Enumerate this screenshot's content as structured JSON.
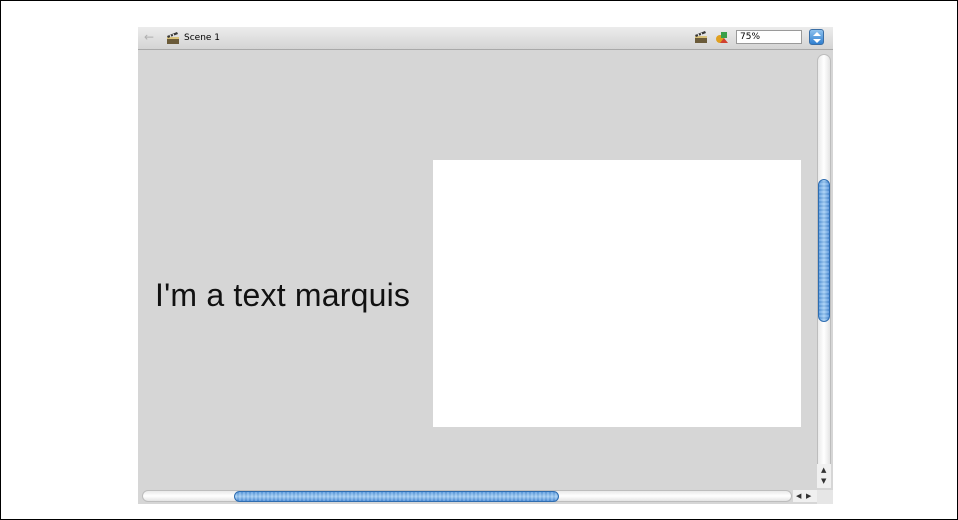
{
  "toolbar": {
    "back_icon": "back-arrow-icon",
    "scene_icon": "clapperboard-icon",
    "scene_label": "Scene 1",
    "edit_scene_icon": "clapperboard-icon",
    "edit_symbol_icon": "symbols-icon",
    "zoom_value": "75%"
  },
  "canvas": {
    "text": "I'm a text marquis",
    "stage_color": "#ffffff",
    "pasteboard_color": "#d6d6d6"
  },
  "scrollbars": {
    "accent": "#5a9be0"
  }
}
